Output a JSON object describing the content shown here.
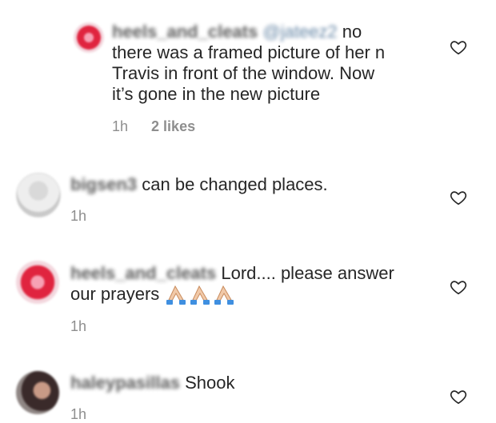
{
  "comments": [
    {
      "username": "heels_and_cleats",
      "mention": "@jateez2",
      "text_line1": " no",
      "text_line2": "there was a framed picture of her n",
      "text_line3": "Travis in front of the window. Now",
      "text_line4": "it’s gone in the new picture",
      "time": "1h",
      "likes": "2 likes"
    },
    {
      "username": "bigsen3",
      "text": " can be changed places.",
      "time": "1h"
    },
    {
      "username": "heels_and_cleats",
      "text_line1": " Lord.... please answer",
      "text_line2": "our prayers ",
      "emoji": "🙏🏼🙏🏼🙏🏼",
      "time": "1h"
    },
    {
      "username": "haleypasillas",
      "text": " Shook",
      "time": "1h"
    }
  ],
  "icons": {
    "like": "heart-outline-icon",
    "emoji": "folded-hands-icon"
  },
  "colors": {
    "text": "#262626",
    "meta": "#8e8e8e",
    "mention": "#00376b"
  }
}
